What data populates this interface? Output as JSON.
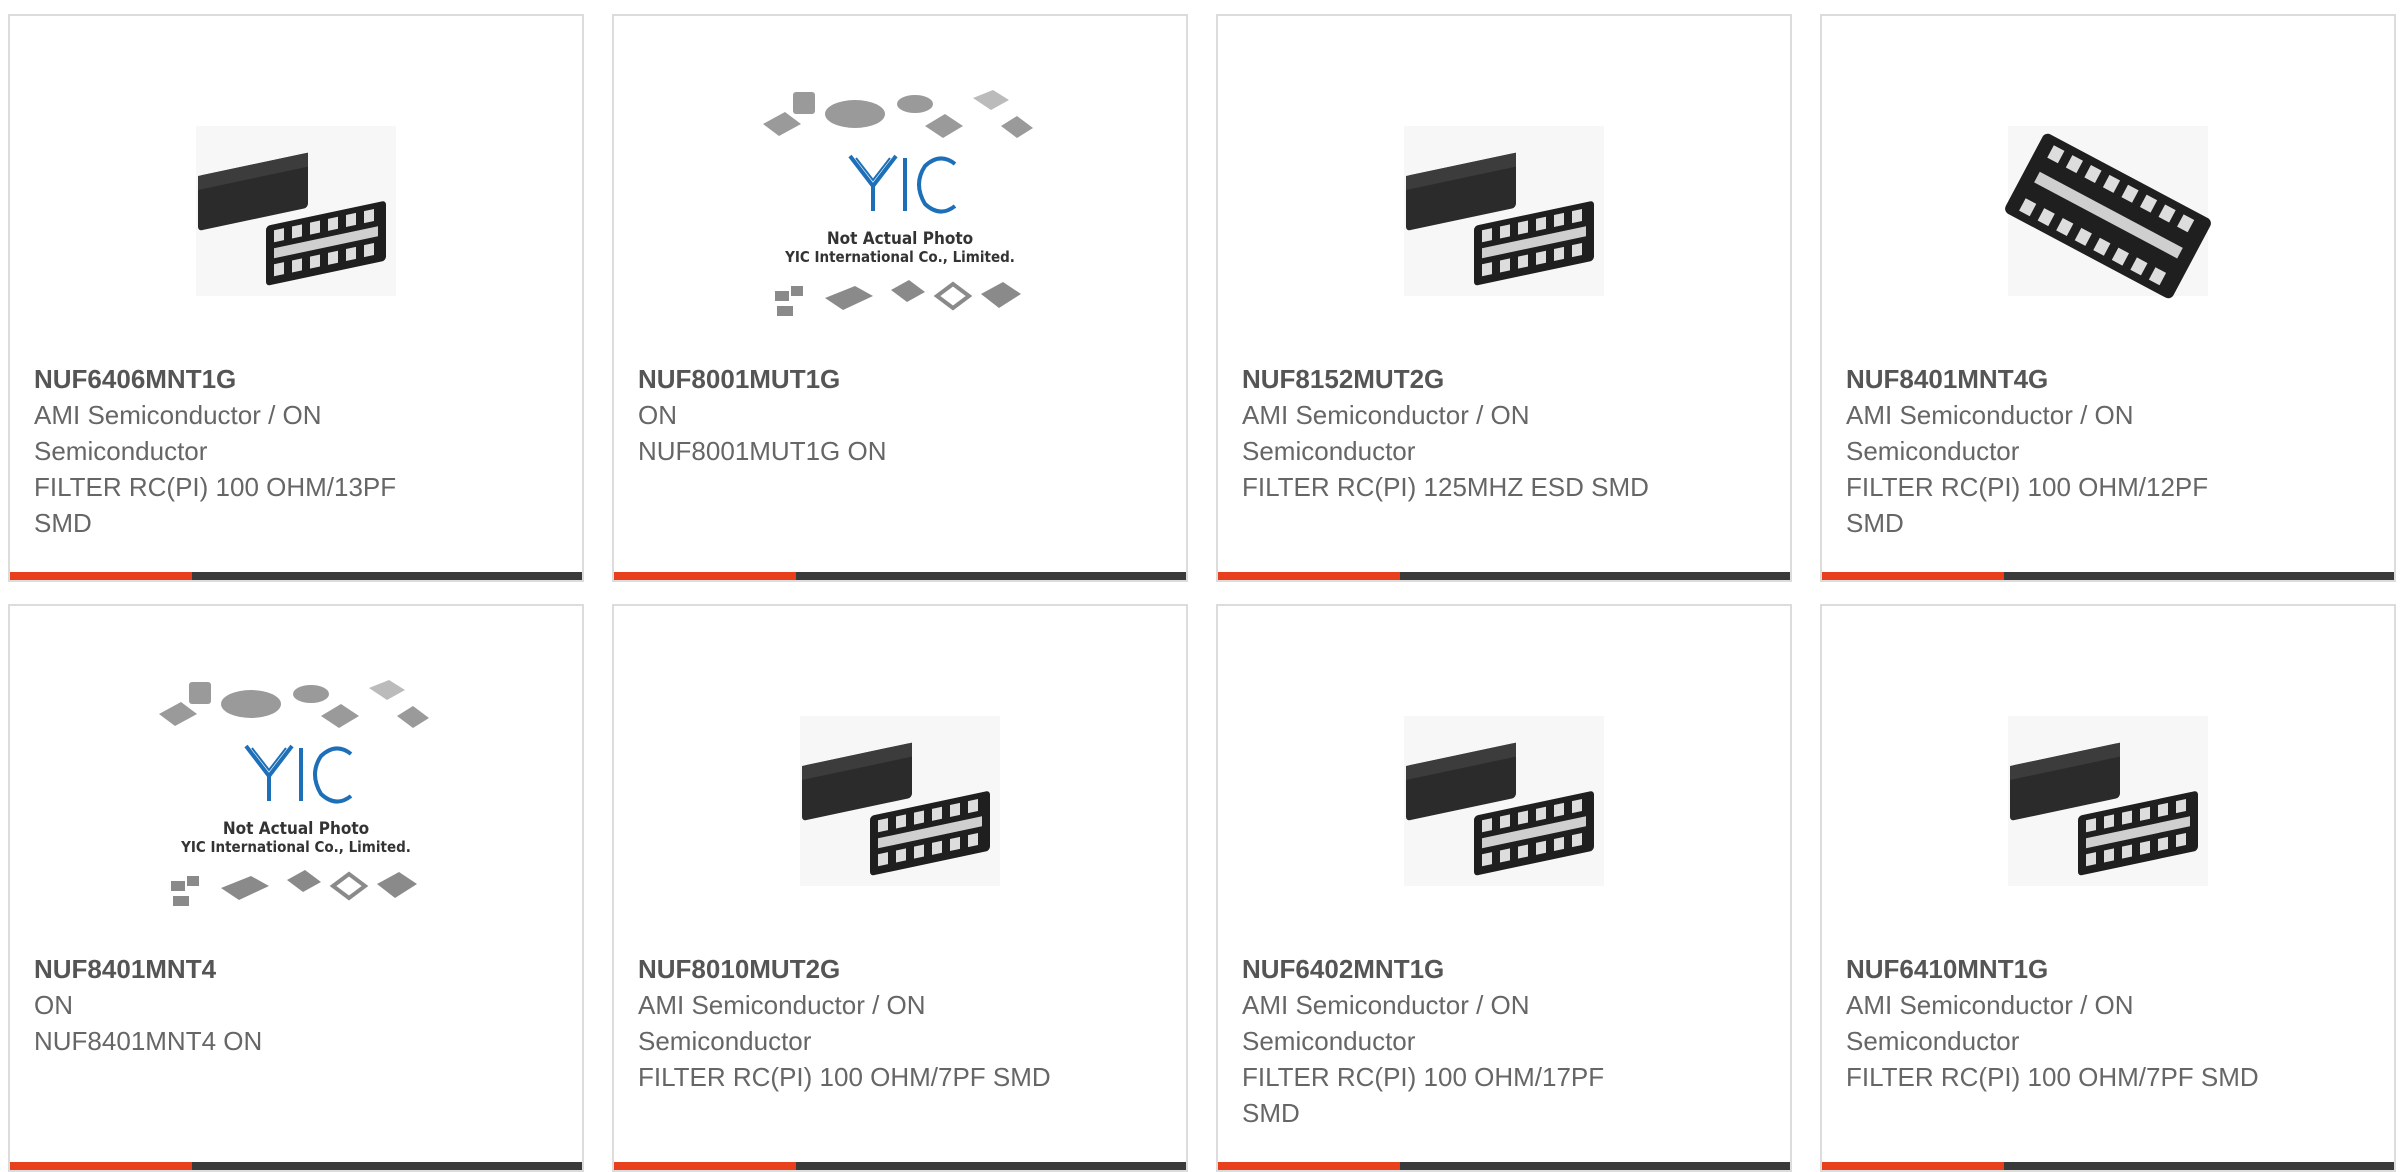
{
  "colors": {
    "accent": "#e8401c",
    "bar": "#3a3a3a",
    "border": "#dcdcdc",
    "text": "#666666",
    "logo_blue": "#1d6fb8"
  },
  "placeholder": {
    "line1": "Not Actual Photo",
    "line2": "YIC International Co., Limited.",
    "logo": "YIC"
  },
  "products": [
    {
      "part": "NUF6406MNT1G",
      "maker": "AMI Semiconductor / ON Semiconductor",
      "desc": "FILTER RC(PI) 100 OHM/13PF SMD",
      "image": "chip-dual-package-icon"
    },
    {
      "part": "NUF8001MUT1G",
      "maker": "ON",
      "desc": "NUF8001MUT1G ON",
      "image": "not-actual-photo-placeholder"
    },
    {
      "part": "NUF8152MUT2G",
      "maker": "AMI Semiconductor / ON Semiconductor",
      "desc": "FILTER RC(PI) 125MHZ ESD SMD",
      "image": "chip-dual-package-icon"
    },
    {
      "part": "NUF8401MNT4G",
      "maker": "AMI Semiconductor / ON Semiconductor",
      "desc": "FILTER RC(PI) 100 OHM/12PF SMD",
      "image": "chip-single-package-icon"
    },
    {
      "part": "NUF8401MNT4",
      "maker": "ON",
      "desc": "NUF8401MNT4 ON",
      "image": "not-actual-photo-placeholder"
    },
    {
      "part": "NUF8010MUT2G",
      "maker": "AMI Semiconductor / ON Semiconductor",
      "desc": "FILTER RC(PI) 100 OHM/7PF SMD",
      "image": "chip-dual-package-icon"
    },
    {
      "part": "NUF6402MNT1G",
      "maker": "AMI Semiconductor / ON Semiconductor",
      "desc": "FILTER RC(PI) 100 OHM/17PF SMD",
      "image": "chip-dual-package-icon"
    },
    {
      "part": "NUF6410MNT1G",
      "maker": "AMI Semiconductor / ON Semiconductor",
      "desc": "FILTER RC(PI) 100 OHM/7PF SMD",
      "image": "chip-dual-package-icon"
    }
  ]
}
